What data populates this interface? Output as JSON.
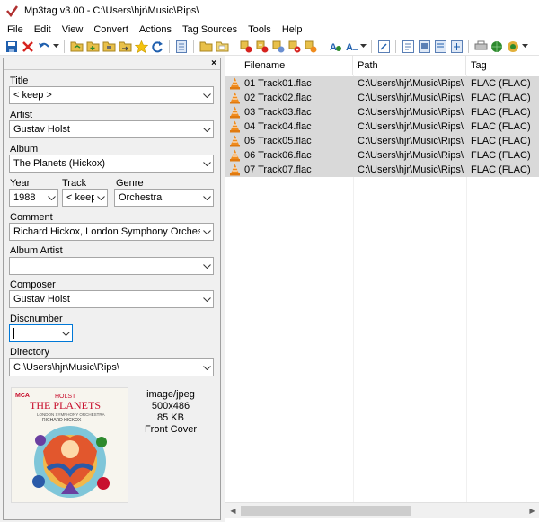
{
  "window": {
    "title": "Mp3tag v3.00  -  C:\\Users\\hjr\\Music\\Rips\\"
  },
  "menu": [
    "File",
    "Edit",
    "View",
    "Convert",
    "Actions",
    "Tag Sources",
    "Tools",
    "Help"
  ],
  "tag_panel": {
    "close": "×",
    "title_label": "Title",
    "title_value": "< keep >",
    "artist_label": "Artist",
    "artist_value": "Gustav Holst",
    "album_label": "Album",
    "album_value": "The Planets (Hickox)",
    "year_label": "Year",
    "year_value": "1988",
    "track_label": "Track",
    "track_value": "< keep",
    "genre_label": "Genre",
    "genre_value": "Orchestral",
    "comment_label": "Comment",
    "comment_value": "Richard Hickox, London Symphony Orchestra",
    "album_artist_label": "Album Artist",
    "album_artist_value": "",
    "composer_label": "Composer",
    "composer_value": "Gustav Holst",
    "discnumber_label": "Discnumber",
    "discnumber_value": "",
    "directory_label": "Directory",
    "directory_value": "C:\\Users\\hjr\\Music\\Rips\\",
    "cover": {
      "mime": "image/jpeg",
      "dimensions": "500x486",
      "size": "85 KB",
      "type": "Front Cover",
      "art_label": "MCA",
      "art_composer": "HOLST",
      "art_title": "THE PLANETS",
      "art_orchestra": "LONDON SYMPHONY ORCHESTRA",
      "art_conductor": "RICHARD HICKOX"
    }
  },
  "file_list": {
    "columns": [
      "Filename",
      "Path",
      "Tag"
    ],
    "rows": [
      {
        "filename": "01 Track01.flac",
        "path": "C:\\Users\\hjr\\Music\\Rips\\",
        "tag": "FLAC (FLAC)"
      },
      {
        "filename": "02 Track02.flac",
        "path": "C:\\Users\\hjr\\Music\\Rips\\",
        "tag": "FLAC (FLAC)"
      },
      {
        "filename": "03 Track03.flac",
        "path": "C:\\Users\\hjr\\Music\\Rips\\",
        "tag": "FLAC (FLAC)"
      },
      {
        "filename": "04 Track04.flac",
        "path": "C:\\Users\\hjr\\Music\\Rips\\",
        "tag": "FLAC (FLAC)"
      },
      {
        "filename": "05 Track05.flac",
        "path": "C:\\Users\\hjr\\Music\\Rips\\",
        "tag": "FLAC (FLAC)"
      },
      {
        "filename": "06 Track06.flac",
        "path": "C:\\Users\\hjr\\Music\\Rips\\",
        "tag": "FLAC (FLAC)"
      },
      {
        "filename": "07 Track07.flac",
        "path": "C:\\Users\\hjr\\Music\\Rips\\",
        "tag": "FLAC (FLAC)"
      }
    ]
  },
  "colors": {
    "selection": "#d9d9d9",
    "focus_border": "#0078d7",
    "cone_orange": "#f08c1e"
  }
}
